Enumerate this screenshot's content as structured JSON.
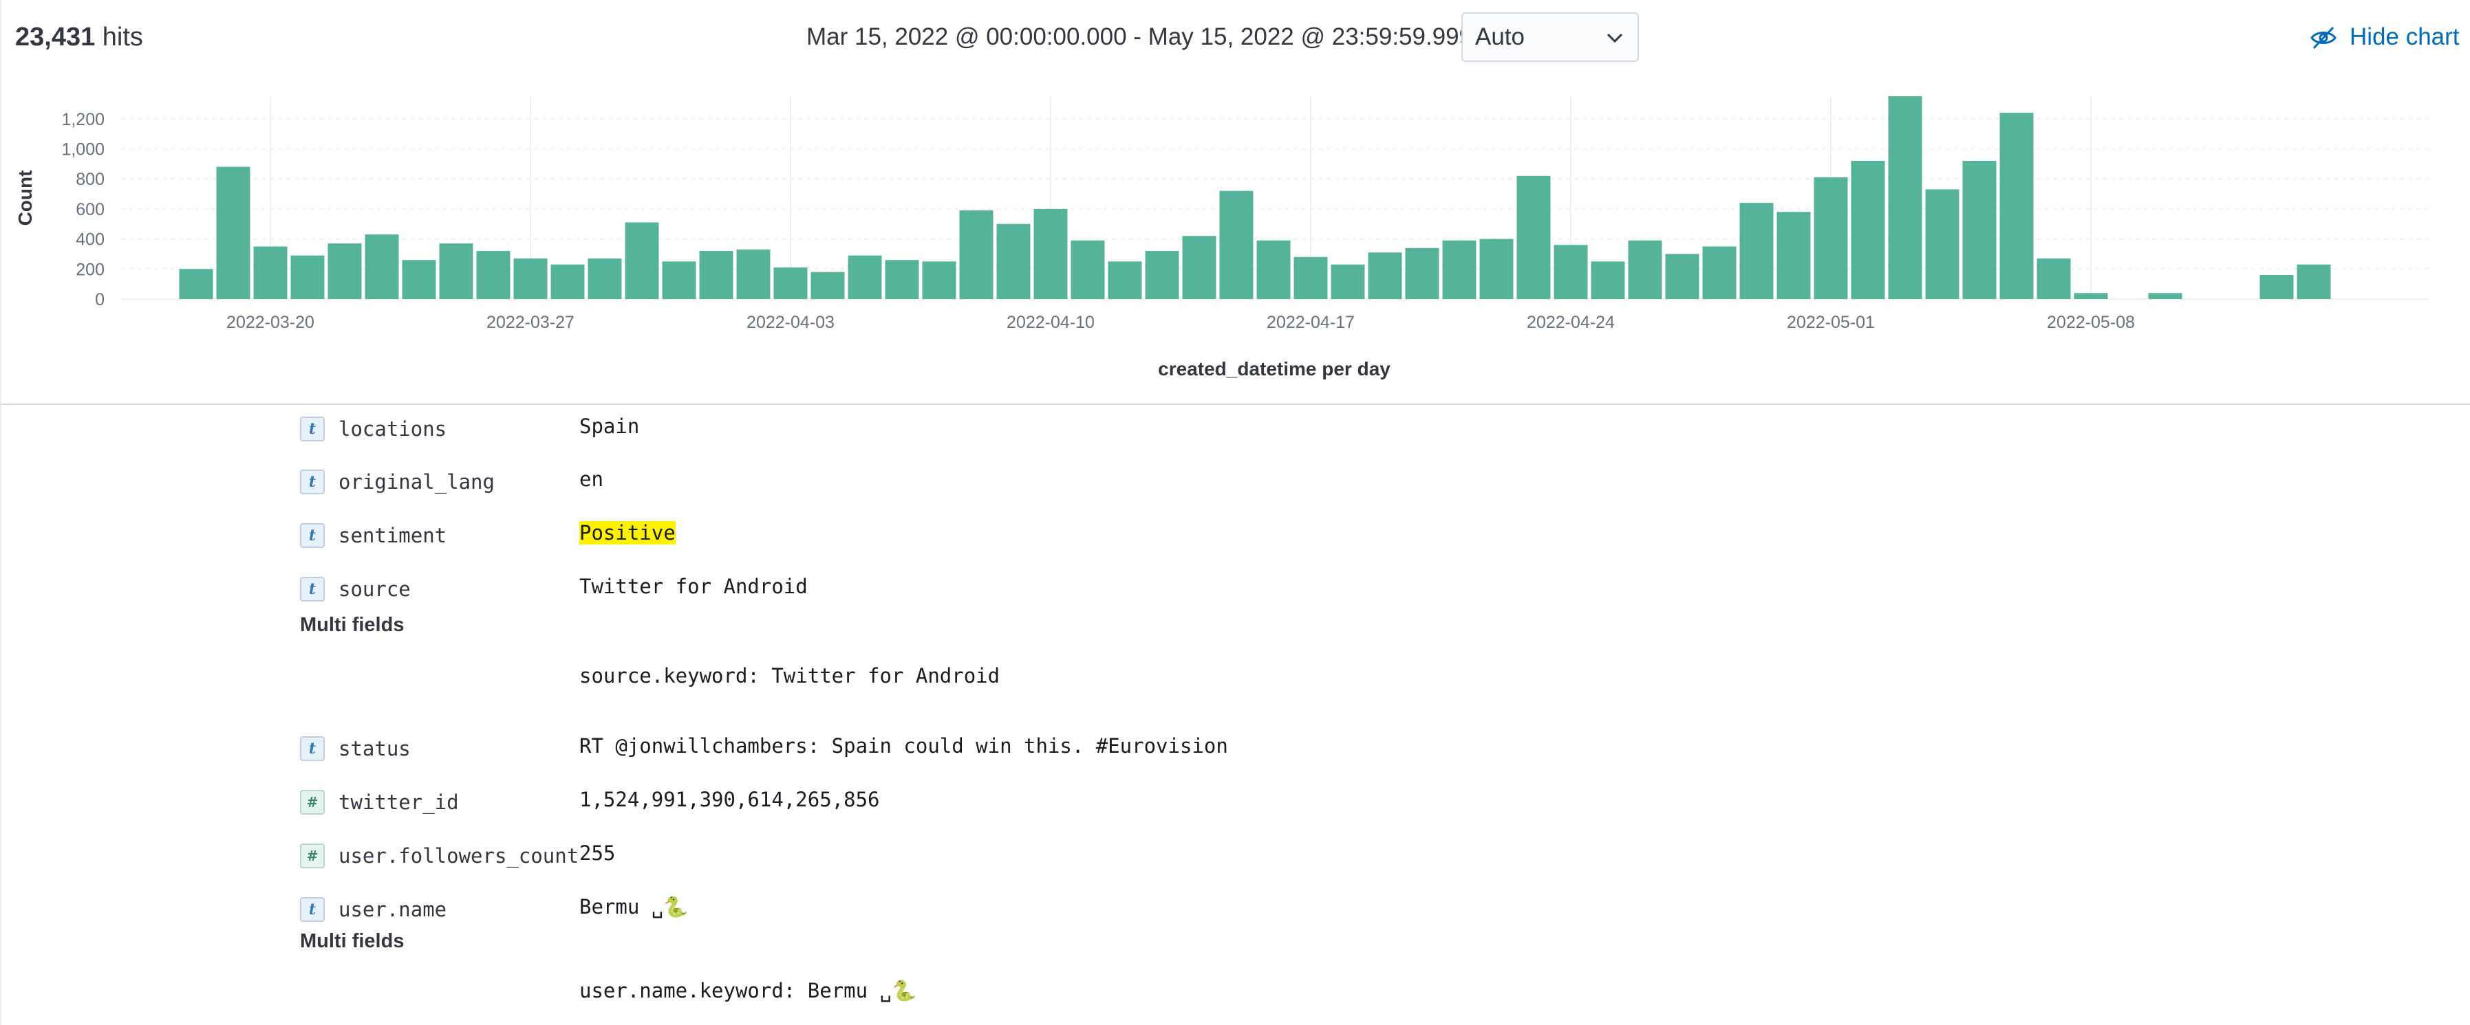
{
  "header": {
    "hits_count": "23,431",
    "hits_label": " hits",
    "time_range": "Mar 15, 2022 @ 00:00:00.000 - May 15, 2022 @ 23:59:59.999",
    "interval": "Auto",
    "hide_chart_label": "Hide chart"
  },
  "chart_data": {
    "type": "bar",
    "title": "",
    "xlabel": "created_datetime per day",
    "ylabel": "Count",
    "ylim": [
      0,
      1350
    ],
    "yticks": [
      0,
      200,
      400,
      600,
      800,
      1000,
      1200
    ],
    "ytick_labels": [
      "0",
      "200",
      "400",
      "600",
      "800",
      "1,000",
      "1,200"
    ],
    "x_start_date": "2022-03-18",
    "xtick_labels": [
      "2022-03-20",
      "2022-03-27",
      "2022-04-03",
      "2022-04-10",
      "2022-04-17",
      "2022-04-24",
      "2022-05-01",
      "2022-05-08"
    ],
    "xtick_dates": [
      "2022-03-20",
      "2022-03-27",
      "2022-04-03",
      "2022-04-10",
      "2022-04-17",
      "2022-04-24",
      "2022-05-01",
      "2022-05-08"
    ],
    "values": [
      200,
      880,
      350,
      290,
      370,
      430,
      260,
      370,
      320,
      270,
      230,
      270,
      510,
      250,
      320,
      330,
      210,
      180,
      290,
      260,
      250,
      590,
      500,
      600,
      390,
      250,
      320,
      420,
      720,
      390,
      280,
      230,
      310,
      340,
      390,
      400,
      820,
      360,
      250,
      390,
      300,
      350,
      640,
      580,
      810,
      920,
      1350,
      730,
      920,
      1240,
      270,
      40,
      0,
      40,
      0,
      0,
      160,
      230
    ],
    "grid": true,
    "colors": {
      "bar": "#54b399",
      "grid": "#eef0f3"
    }
  },
  "document": {
    "fields": [
      {
        "type": "t",
        "name": "locations",
        "value": "Spain"
      },
      {
        "type": "t",
        "name": "original_lang",
        "value": "en"
      },
      {
        "type": "t",
        "name": "sentiment",
        "value": "Positive",
        "highlight": true
      },
      {
        "type": "t",
        "name": "source",
        "value": "Twitter for Android"
      },
      {
        "type": "t",
        "name": "status",
        "value": "RT @jonwillchambers: Spain could win this. #Eurovision"
      },
      {
        "type": "#",
        "name": "twitter_id",
        "value": "1,524,991,390,614,265,856"
      },
      {
        "type": "#",
        "name": "user.followers_count",
        "value": "255"
      },
      {
        "type": "t",
        "name": "user.name",
        "value": "Bermu ␣🐍"
      }
    ],
    "multi_fields_heading": "Multi fields",
    "source_keyword": "source.keyword: Twitter for Android",
    "user_name_keyword": "user.name.keyword: Bermu ␣🐍"
  }
}
